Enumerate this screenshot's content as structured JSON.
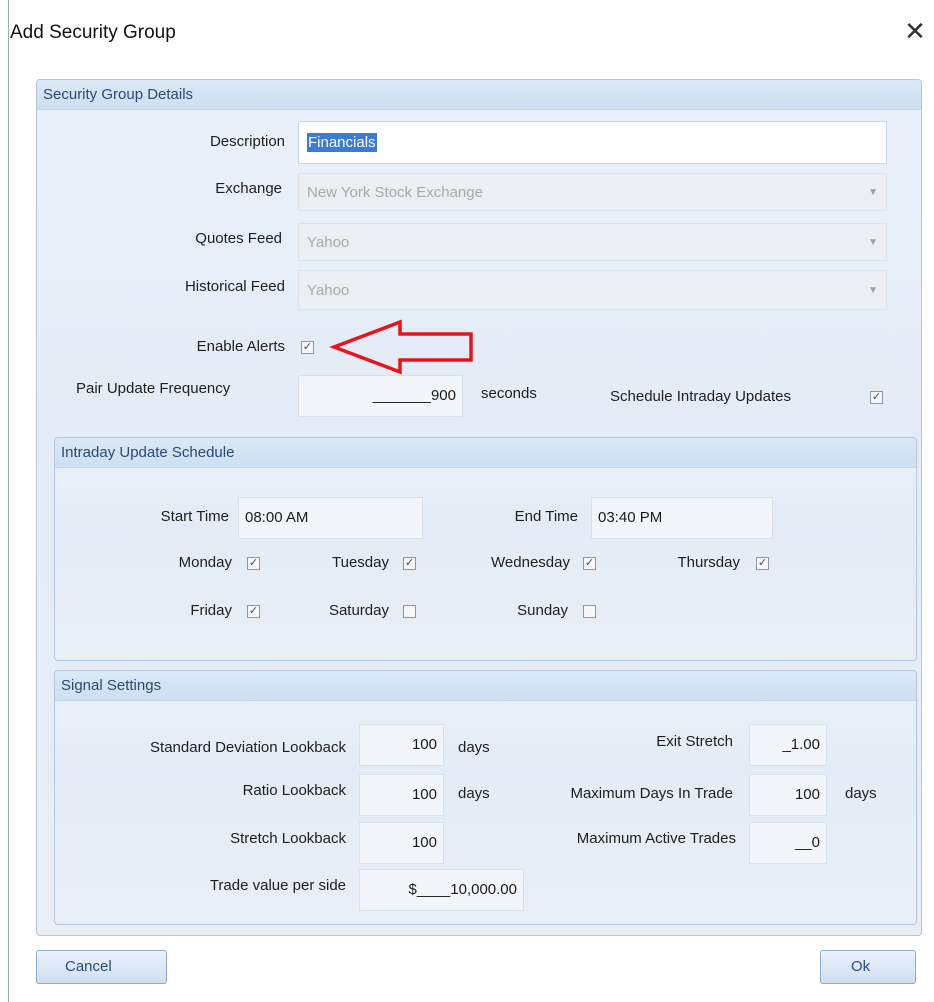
{
  "window": {
    "title": "Add Security Group",
    "close_glyph": "✕",
    "close_icon": "close-icon"
  },
  "details": {
    "title": "Security Group Details",
    "description": {
      "label": "Description",
      "value": "Financials"
    },
    "exchange": {
      "label": "Exchange",
      "value": "New York Stock Exchange"
    },
    "quotes_feed": {
      "label": "Quotes Feed",
      "value": "Yahoo"
    },
    "historical_feed": {
      "label": "Historical Feed",
      "value": "Yahoo"
    },
    "enable_alerts": {
      "label": "Enable Alerts",
      "checked": true
    },
    "pair_update": {
      "label": "Pair Update Frequency",
      "value": "_______900",
      "unit": "seconds"
    },
    "schedule_intraday": {
      "label": "Schedule Intraday Updates",
      "checked": true
    },
    "annotation": {
      "icon": "red-arrow-icon",
      "color": "#e8141c"
    }
  },
  "intraday": {
    "title": "Intraday Update Schedule",
    "start_time": {
      "label": "Start Time",
      "value": "08:00 AM"
    },
    "end_time": {
      "label": "End Time",
      "value": "03:40 PM"
    },
    "days": [
      {
        "label": "Monday",
        "checked": true
      },
      {
        "label": "Tuesday",
        "checked": true
      },
      {
        "label": "Wednesday",
        "checked": true
      },
      {
        "label": "Thursday",
        "checked": true
      },
      {
        "label": "Friday",
        "checked": true
      },
      {
        "label": "Saturday",
        "checked": false
      },
      {
        "label": "Sunday",
        "checked": false
      }
    ]
  },
  "signal": {
    "title": "Signal Settings",
    "std_dev_lookback": {
      "label": "Standard Deviation Lookback",
      "value": "100",
      "unit": "days"
    },
    "ratio_lookback": {
      "label": "Ratio Lookback",
      "value": "100",
      "unit": "days"
    },
    "stretch_lookback": {
      "label": "Stretch Lookback",
      "value": "100"
    },
    "trade_value": {
      "label": "Trade value per side",
      "value": "$____10,000.00"
    },
    "exit_stretch": {
      "label": "Exit Stretch",
      "value": "_1.00"
    },
    "max_days": {
      "label": "Maximum Days In Trade",
      "value": "100",
      "unit": "days"
    },
    "max_active": {
      "label": "Maximum Active Trades",
      "value": "__0"
    }
  },
  "buttons": {
    "cancel": "Cancel",
    "ok": "Ok"
  },
  "colors": {
    "accent": "#2a4a73",
    "group_bg": "#e5edf6",
    "border": "#b3c6dc"
  }
}
